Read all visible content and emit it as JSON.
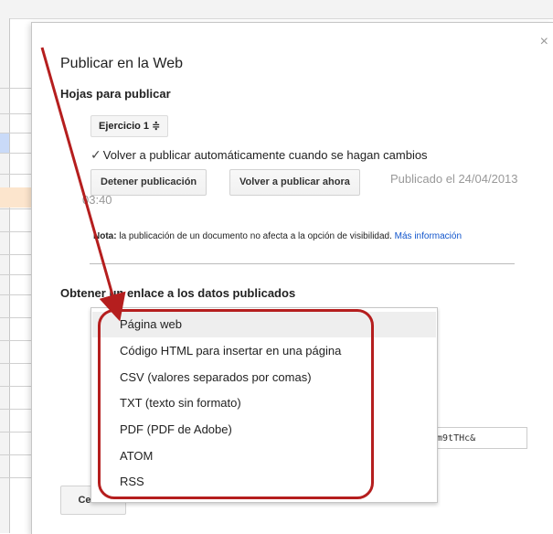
{
  "dialog": {
    "title": "Publicar en la Web",
    "close_symbol": "×"
  },
  "sheets_section": {
    "heading": "Hojas para publicar",
    "sheet_select": "Ejercicio 1 ≑",
    "auto_republish_label": "Volver a publicar automáticamente cuando se hagan cambios",
    "auto_republish_checked": true,
    "stop_button": "Detener publicación",
    "republish_button": "Volver a publicar ahora",
    "published_prefix": "Publicado el 24/04/2013",
    "published_time": "03:40"
  },
  "note": {
    "label": "Nota:",
    "text": " la publicación de un documento no afecta a la opción de visibilidad. ",
    "link": "Más información"
  },
  "link_section": {
    "heading": "Obtener un enlace a los datos publicados",
    "format_options": [
      "Página web",
      "Código HTML para insertar en una página",
      "CSV (valores separados por comas)",
      "TXT (texto sin formato)",
      "PDF (PDF de Adobe)",
      "ATOM",
      "RSS"
    ],
    "selected_index": 0,
    "link_field_tail": "am9tTHc&"
  },
  "footer": {
    "close_button": "Cerrar"
  },
  "colors": {
    "annotation_red": "#b51e1e",
    "link_blue": "#1155cc"
  }
}
